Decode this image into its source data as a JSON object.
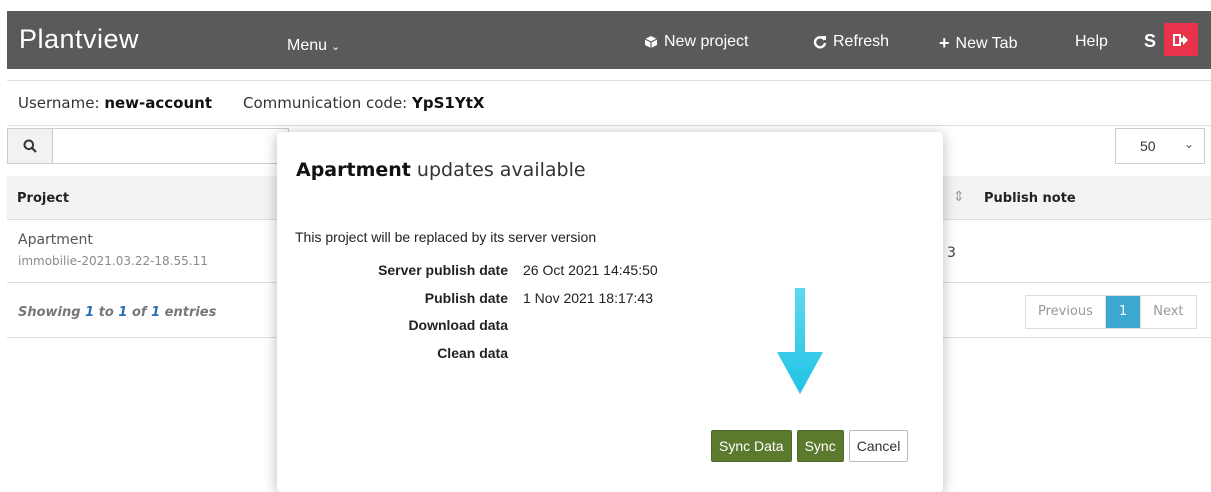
{
  "app": {
    "brand": "Plantview",
    "menu_label": "Menu",
    "nav": {
      "new_project": "New project",
      "refresh": "Refresh",
      "new_tab": "New Tab",
      "help": "Help",
      "user_initial": "S"
    },
    "colors": {
      "navbar": "#5a5a5a",
      "logout": "#e8334a",
      "accent_green": "#5b7a2e",
      "pager_active": "#3ca8d0"
    }
  },
  "userbar": {
    "username_label": "Username:",
    "username": "new-account",
    "code_label": "Communication code:",
    "code": "YpS1YtX"
  },
  "search": {
    "placeholder": "",
    "value": ""
  },
  "page_size": {
    "selected": "50"
  },
  "table": {
    "columns": [
      "Project",
      "Publish note"
    ],
    "rows": [
      {
        "name": "Apartment",
        "sub": "immobilie-2021.03.22-18.55.11",
        "col3_partial": "3"
      }
    ]
  },
  "footer": {
    "showing_prefix": "Showing",
    "from": "1",
    "to_word": "to",
    "to": "1",
    "of_word": "of",
    "total": "1",
    "suffix": "entries",
    "pager": {
      "prev": "Previous",
      "current": "1",
      "next": "Next"
    }
  },
  "modal": {
    "title_bold": "Apartment",
    "title_rest": " updates available",
    "message": "This project will be replaced by its server version",
    "rows": [
      {
        "label": "Server publish date",
        "value": "26 Oct 2021 14:45:50"
      },
      {
        "label": "Publish date",
        "value": "1 Nov 2021 18:17:43"
      },
      {
        "label": "Download data",
        "value": ""
      },
      {
        "label": "Clean data",
        "value": ""
      }
    ],
    "buttons": {
      "sync_data": "Sync Data",
      "sync": "Sync",
      "cancel": "Cancel"
    }
  },
  "icons": {
    "new_project": "cube-icon",
    "refresh": "refresh-icon",
    "new_tab": "plus-icon",
    "logout": "sign-out-icon",
    "search": "search-icon",
    "arrow": "arrow-down-icon"
  }
}
